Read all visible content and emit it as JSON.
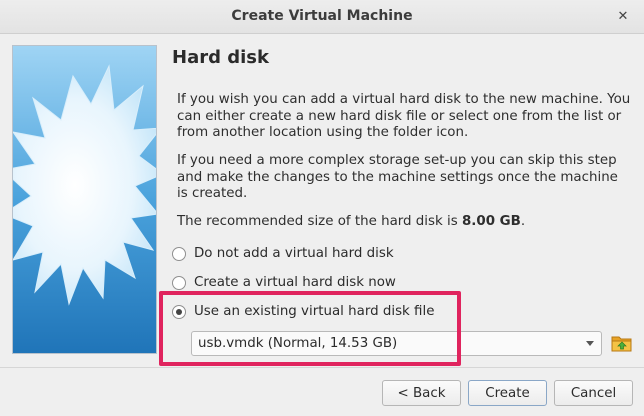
{
  "window": {
    "title": "Create Virtual Machine",
    "close_icon": "close-icon"
  },
  "page": {
    "heading": "Hard disk",
    "paragraph1": "If you wish you can add a virtual hard disk to the new machine. You can either create a new hard disk file or select one from the list or from another location using the folder icon.",
    "paragraph2": "If you need a more complex storage set-up you can skip this step and make the changes to the machine settings once the machine is created.",
    "recommended_prefix": "The recommended size of the hard disk is ",
    "recommended_value": "8.00 GB",
    "recommended_suffix": "."
  },
  "options": [
    {
      "label": "Do not add a virtual hard disk",
      "checked": false
    },
    {
      "label": "Create a virtual hard disk now",
      "checked": false
    },
    {
      "label": "Use an existing virtual hard disk file",
      "checked": true
    }
  ],
  "disk_select": {
    "value": "usb.vmdk (Normal, 14.53 GB)"
  },
  "buttons": {
    "back": "< Back",
    "create": "Create",
    "cancel": "Cancel"
  },
  "colors": {
    "highlight": "#e0245e",
    "sidebar_blue": "#5aa7dc"
  }
}
